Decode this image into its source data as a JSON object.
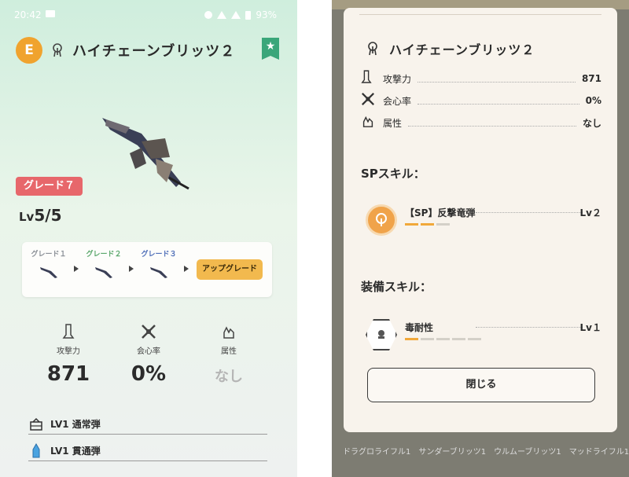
{
  "left": {
    "status": {
      "time": "20:42",
      "battery": "93%"
    },
    "header": {
      "rank": "E",
      "weapon_name": "ハイチェーンブリッツ２"
    },
    "grade_badge": "グレード７",
    "level": {
      "prefix": "Lv",
      "value": "5/5"
    },
    "grade_steps": [
      {
        "label": "グレード１",
        "color": "#8a8f96"
      },
      {
        "label": "グレード２",
        "color": "#5aa76b"
      },
      {
        "label": "グレード３",
        "color": "#4f6fb8"
      }
    ],
    "upgrade_button": "アップグレード",
    "stats": [
      {
        "label": "攻撃力",
        "value": "871"
      },
      {
        "label": "会心率",
        "value": "0%"
      },
      {
        "label": "属性",
        "value": "なし"
      }
    ],
    "ammo": [
      {
        "text": "LV1 通常弾"
      },
      {
        "text": "LV1 貫通弾"
      }
    ]
  },
  "right": {
    "weapon_name": "ハイチェーンブリッツ２",
    "stats": [
      {
        "label": "攻撃力",
        "value": "871"
      },
      {
        "label": "会心率",
        "value": "0%"
      },
      {
        "label": "属性",
        "value": "なし"
      }
    ],
    "sp_skills_title": "SPスキル：",
    "sp_skills": [
      {
        "name": "【SP】反撃竜弾",
        "level": "Lv２",
        "filled": 2,
        "total": 3
      }
    ],
    "equip_skills_title": "装備スキル：",
    "equip_skills": [
      {
        "name": "毒耐性",
        "level": "Lv１",
        "filled": 1,
        "total": 5
      }
    ],
    "close_button": "閉じる",
    "bottom_tabs": [
      "ドラグロライフル1",
      "サンダーブリッツ1",
      "ウルムーブリッツ1",
      "マッドライフル1"
    ]
  },
  "colors": {
    "rank_badge": "#f0a32e",
    "bookmark": "#3aa67a",
    "grade_badge": "#e7676b",
    "upgrade_button": "#f2b94e",
    "sp_icon": "#f0a34a",
    "skill_bar_on": "#f1a83a"
  }
}
